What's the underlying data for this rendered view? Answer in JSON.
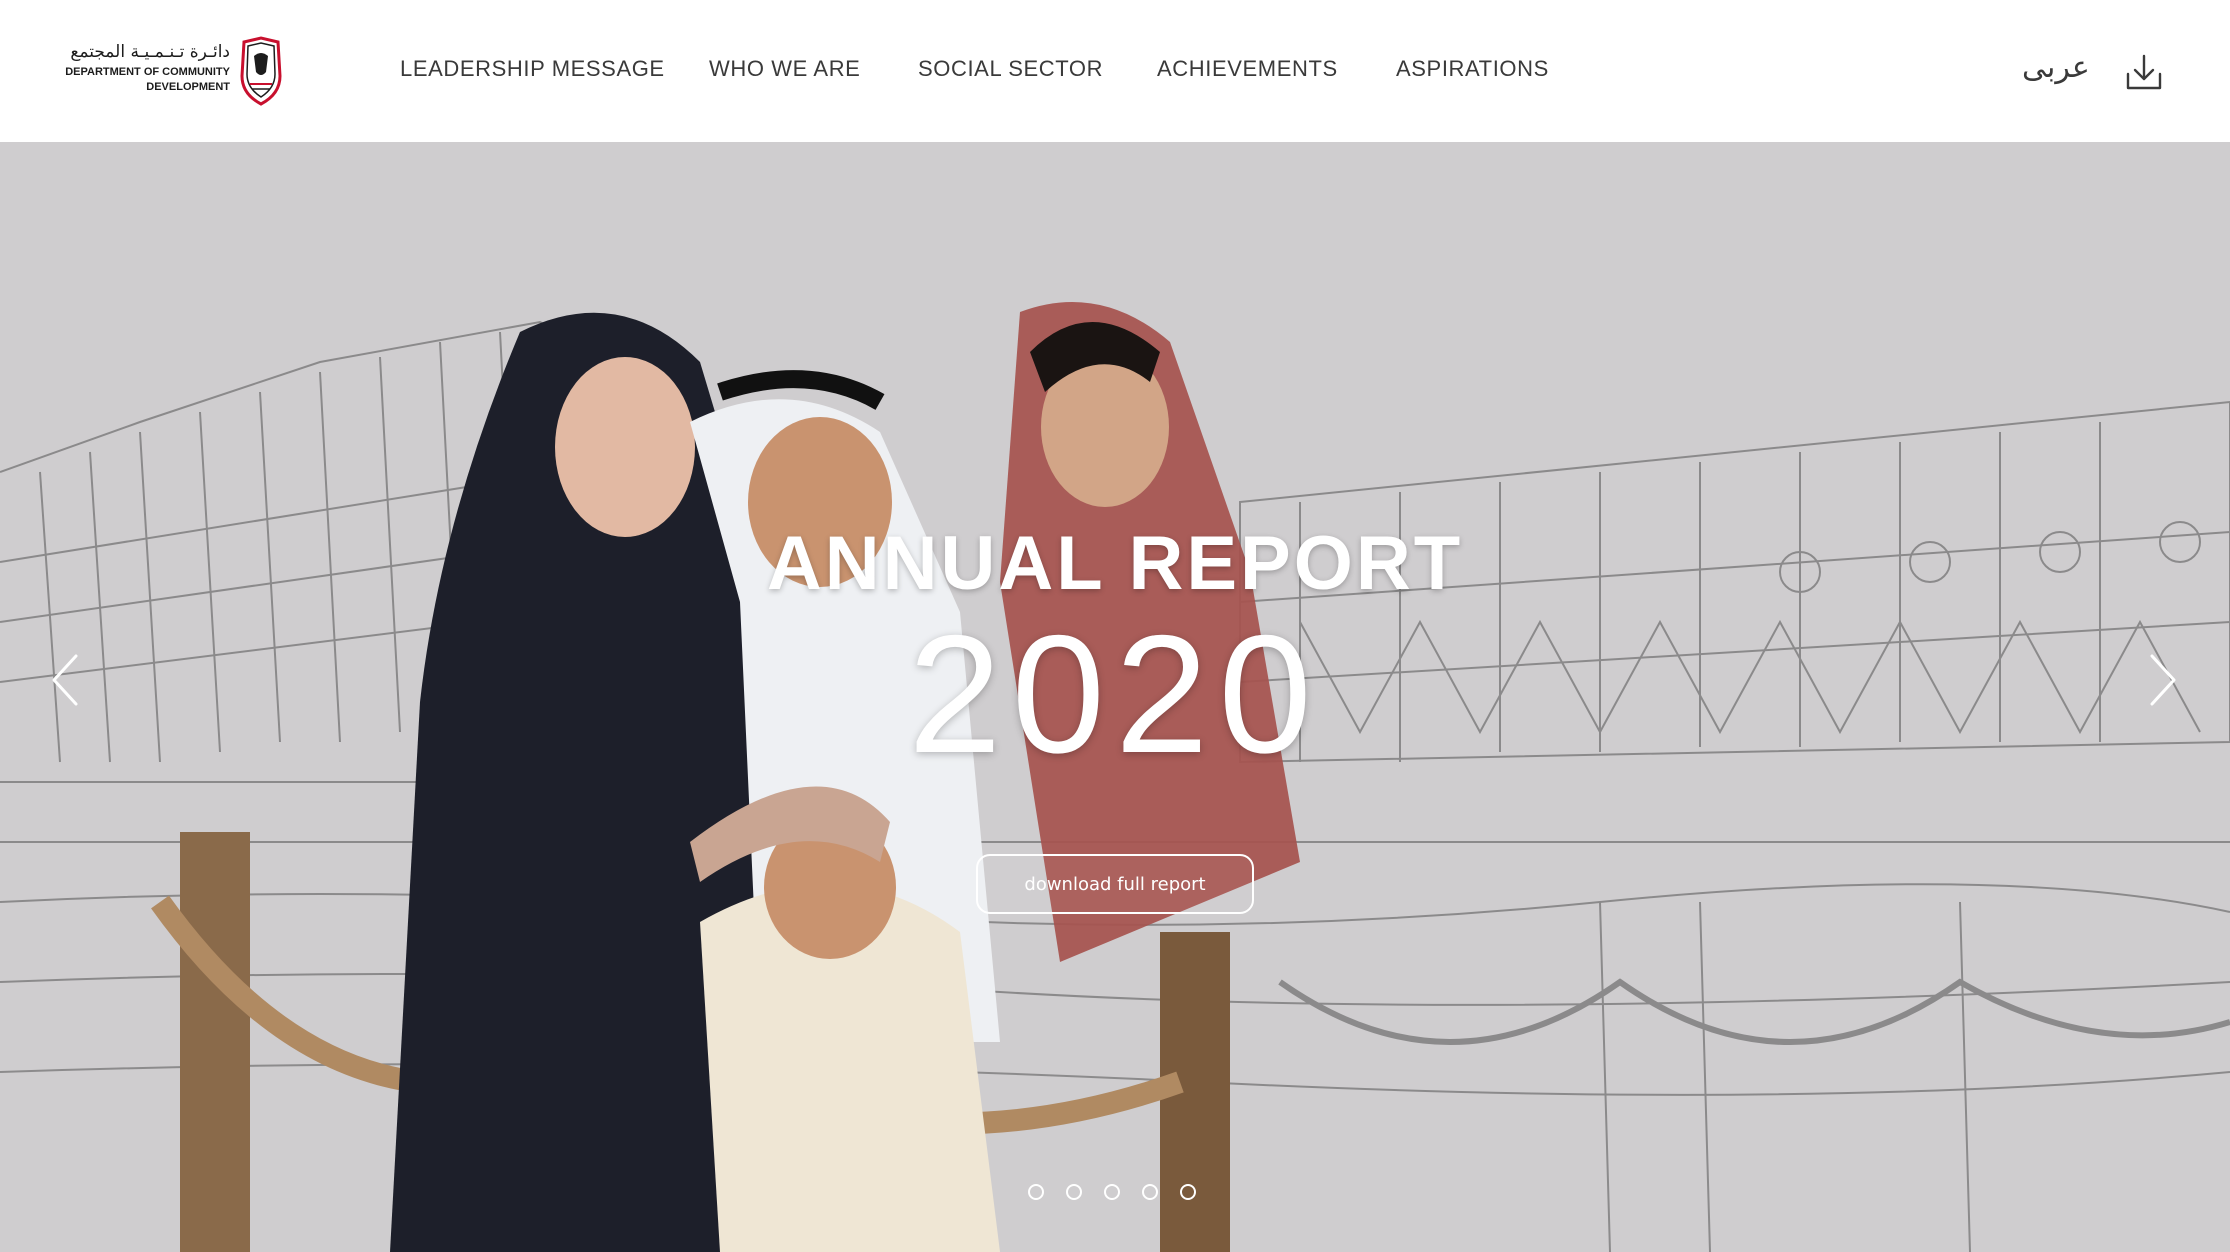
{
  "header": {
    "logo": {
      "arabic_name": "دائـرة تـنـمـيـة المجتمع",
      "english_name": "DEPARTMENT OF COMMUNITY DEVELOPMENT"
    },
    "nav": [
      {
        "label": "LEADERSHIP MESSAGE"
      },
      {
        "label": "WHO WE ARE"
      },
      {
        "label": "SOCIAL SECTOR"
      },
      {
        "label": "ACHIEVEMENTS"
      },
      {
        "label": "ASPIRATIONS"
      }
    ],
    "language_link": "عربى",
    "download_icon": "download-icon"
  },
  "hero": {
    "title": "ANNUAL REPORT",
    "year": "2020",
    "cta_label": "download full report",
    "slide_count": 5,
    "active_slide": 1,
    "prev_icon": "chevron-left-icon",
    "next_icon": "chevron-right-icon"
  },
  "colors": {
    "header_bg": "#ffffff",
    "nav_text": "#3a3a3a",
    "hero_bg": "#cdcbcd",
    "hero_text": "#ffffff",
    "emblem_red": "#c8102e"
  }
}
